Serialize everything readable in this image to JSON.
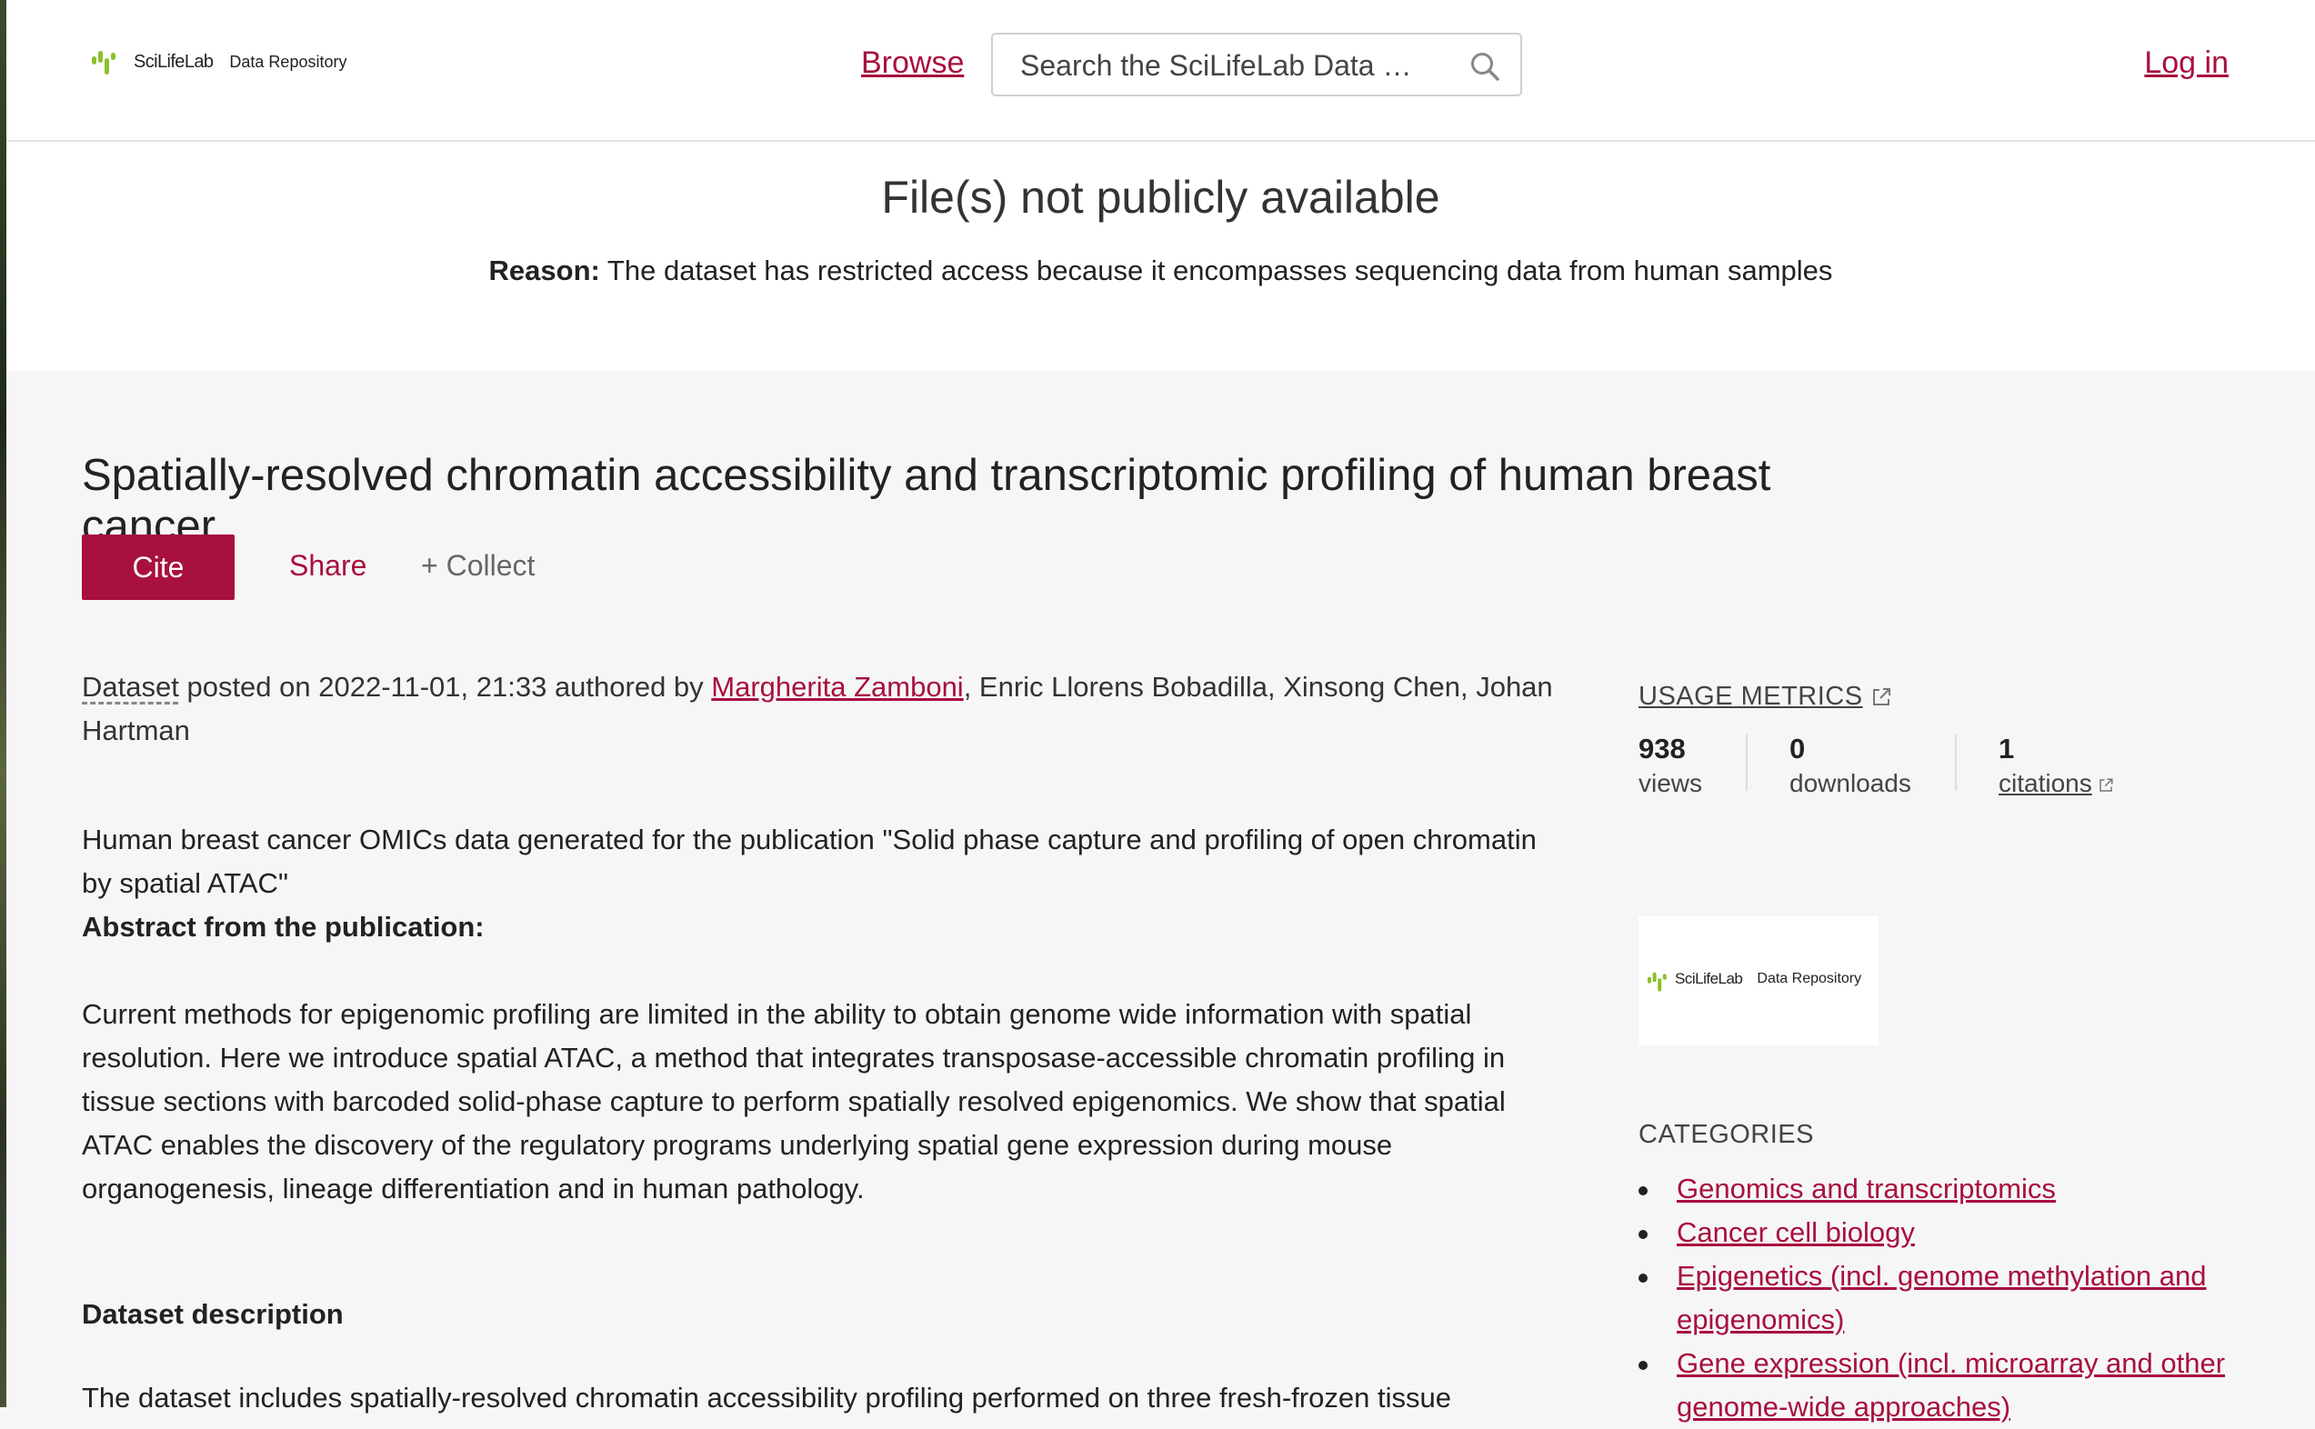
{
  "header": {
    "logo_brand": "SciLifeLab",
    "logo_sub": "Data Repository",
    "browse_label": "Browse",
    "search_placeholder": "Search the SciLifeLab Data …",
    "login_label": "Log in"
  },
  "notice": {
    "title": "File(s) not publicly available",
    "reason_label": "Reason:",
    "reason_text": "The dataset has restricted access because it encompasses sequencing data from human samples"
  },
  "article": {
    "title": "Spatially-resolved chromatin accessibility and transcriptomic profiling of human breast cancer",
    "actions": {
      "cite": "Cite",
      "share": "Share",
      "collect": "+ Collect"
    },
    "item_type": "Dataset",
    "posted_prefix": " posted on ",
    "posted_date": "2022-11-01, 21:33",
    "authored_by": " authored by ",
    "first_author": "Margherita Zamboni",
    "other_authors": ", Enric Llorens Bobadilla, Xinsong Chen, Johan Hartman",
    "intro": "Human breast cancer OMICs data generated for the publication \"Solid phase capture and profiling of open chromatin by spatial ATAC\"",
    "abstract_heading": "Abstract from the publication:",
    "abstract": "Current methods for epigenomic profiling are limited in the ability to obtain genome wide information with spatial resolution. Here we introduce spatial ATAC, a method that integrates transposase-accessible chromatin profiling in tissue sections with barcoded solid-phase capture to perform spatially resolved epigenomics. We show that spatial ATAC enables the discovery of the regulatory programs underlying spatial gene expression during mouse organogenesis, lineage differentiation and in human pathology.",
    "dataset_heading": "Dataset description",
    "dataset_text": "The dataset includes spatially-resolved chromatin accessibility profiling performed on three fresh-frozen tissue"
  },
  "sidebar": {
    "usage_title": "USAGE METRICS",
    "metrics": [
      {
        "value": "938",
        "label": "views"
      },
      {
        "value": "0",
        "label": "downloads"
      },
      {
        "value": "1",
        "label": "citations"
      }
    ],
    "categories_title": "CATEGORIES",
    "categories": [
      "Genomics and transcriptomics",
      "Cancer cell biology",
      "Epigenetics (incl. genome methylation and epigenomics)",
      "Gene expression (incl. microarray and other genome-wide approaches)"
    ]
  },
  "colors": {
    "accent": "#a8103e",
    "brand_green": "#8dbf2c",
    "page_bg": "#f6f6f6"
  }
}
